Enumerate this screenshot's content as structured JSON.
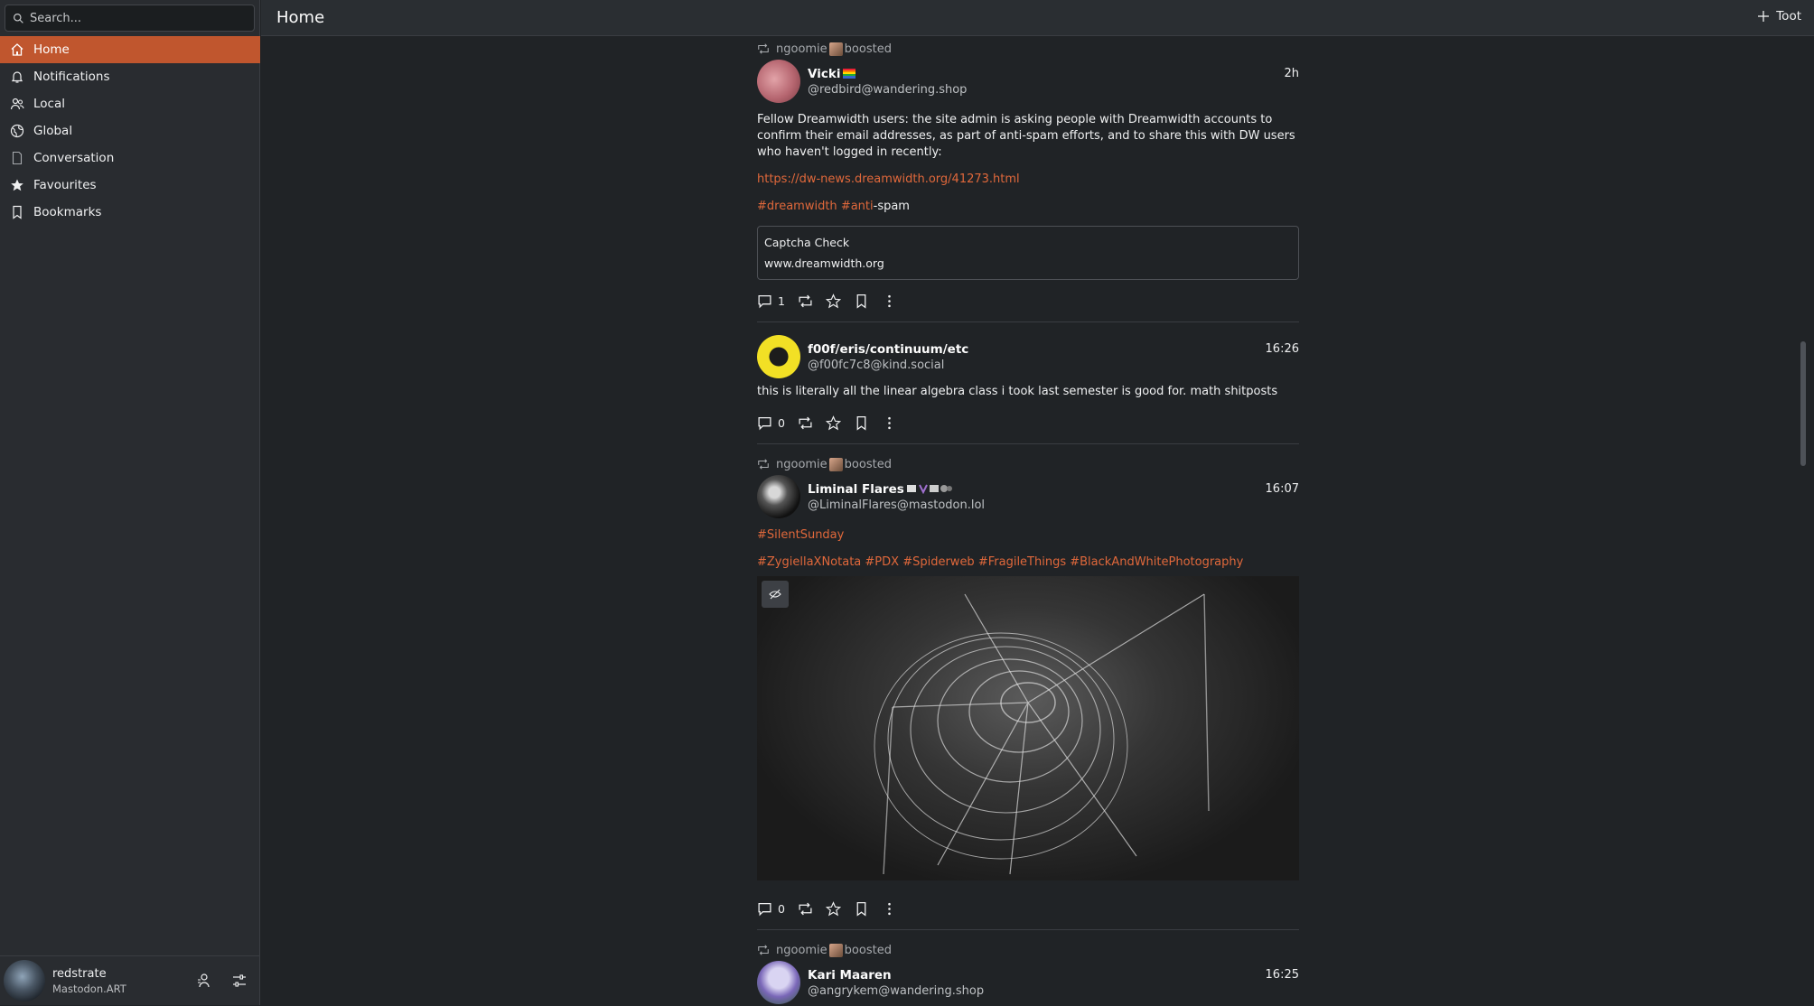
{
  "sidebar": {
    "search_placeholder": "Search...",
    "items": [
      {
        "label": "Home",
        "icon": "home-icon"
      },
      {
        "label": "Notifications",
        "icon": "bell-icon"
      },
      {
        "label": "Local",
        "icon": "users-icon"
      },
      {
        "label": "Global",
        "icon": "globe-icon"
      },
      {
        "label": "Conversation",
        "icon": "document-icon"
      },
      {
        "label": "Favourites",
        "icon": "star-icon"
      },
      {
        "label": "Bookmarks",
        "icon": "bookmark-icon"
      }
    ],
    "active_index": 0
  },
  "account": {
    "name": "redstrate",
    "instance": "Mastodon.ART"
  },
  "header": {
    "title": "Home",
    "toot_label": "Toot"
  },
  "posts": [
    {
      "boosted_by": "ngoomie",
      "boosted_label": "boosted",
      "display_name": "Vicki",
      "handle": "@redbird@wandering.shop",
      "time": "2h",
      "text": "Fellow Dreamwidth users: the site admin is asking people with Dreamwidth accounts to confirm their email addresses, as part of anti-spam efforts, and to share this with DW users who haven't logged in recently:",
      "link": "https://dw-news.dreamwidth.org/41273.html",
      "tag1": "#dreamwidth",
      "tag2": "#anti",
      "tag2_suffix": "-spam",
      "card_title": "Captcha Check",
      "card_url": "www.dreamwidth.org",
      "replies": "1"
    },
    {
      "display_name": "f00f/eris/continuum/etc",
      "handle": "@f00fc7c8@kind.social",
      "time": "16:26",
      "text": "this is literally all the linear algebra class i took last semester is good for. math shitposts",
      "replies": "0"
    },
    {
      "boosted_by": "ngoomie",
      "boosted_label": "boosted",
      "display_name": "Liminal Flares",
      "handle": "@LiminalFlares@mastodon.lol",
      "time": "16:07",
      "tag_line1": "#SilentSunday",
      "tags": [
        "#ZygiellaXNotata",
        "#PDX",
        "#Spiderweb",
        "#FragileThings",
        "#BlackAndWhitePhotography"
      ],
      "replies": "0"
    },
    {
      "boosted_by": "ngoomie",
      "boosted_label": "boosted",
      "display_name": "Kari Maaren",
      "handle": "@angrykem@wandering.shop",
      "time": "16:25"
    }
  ]
}
